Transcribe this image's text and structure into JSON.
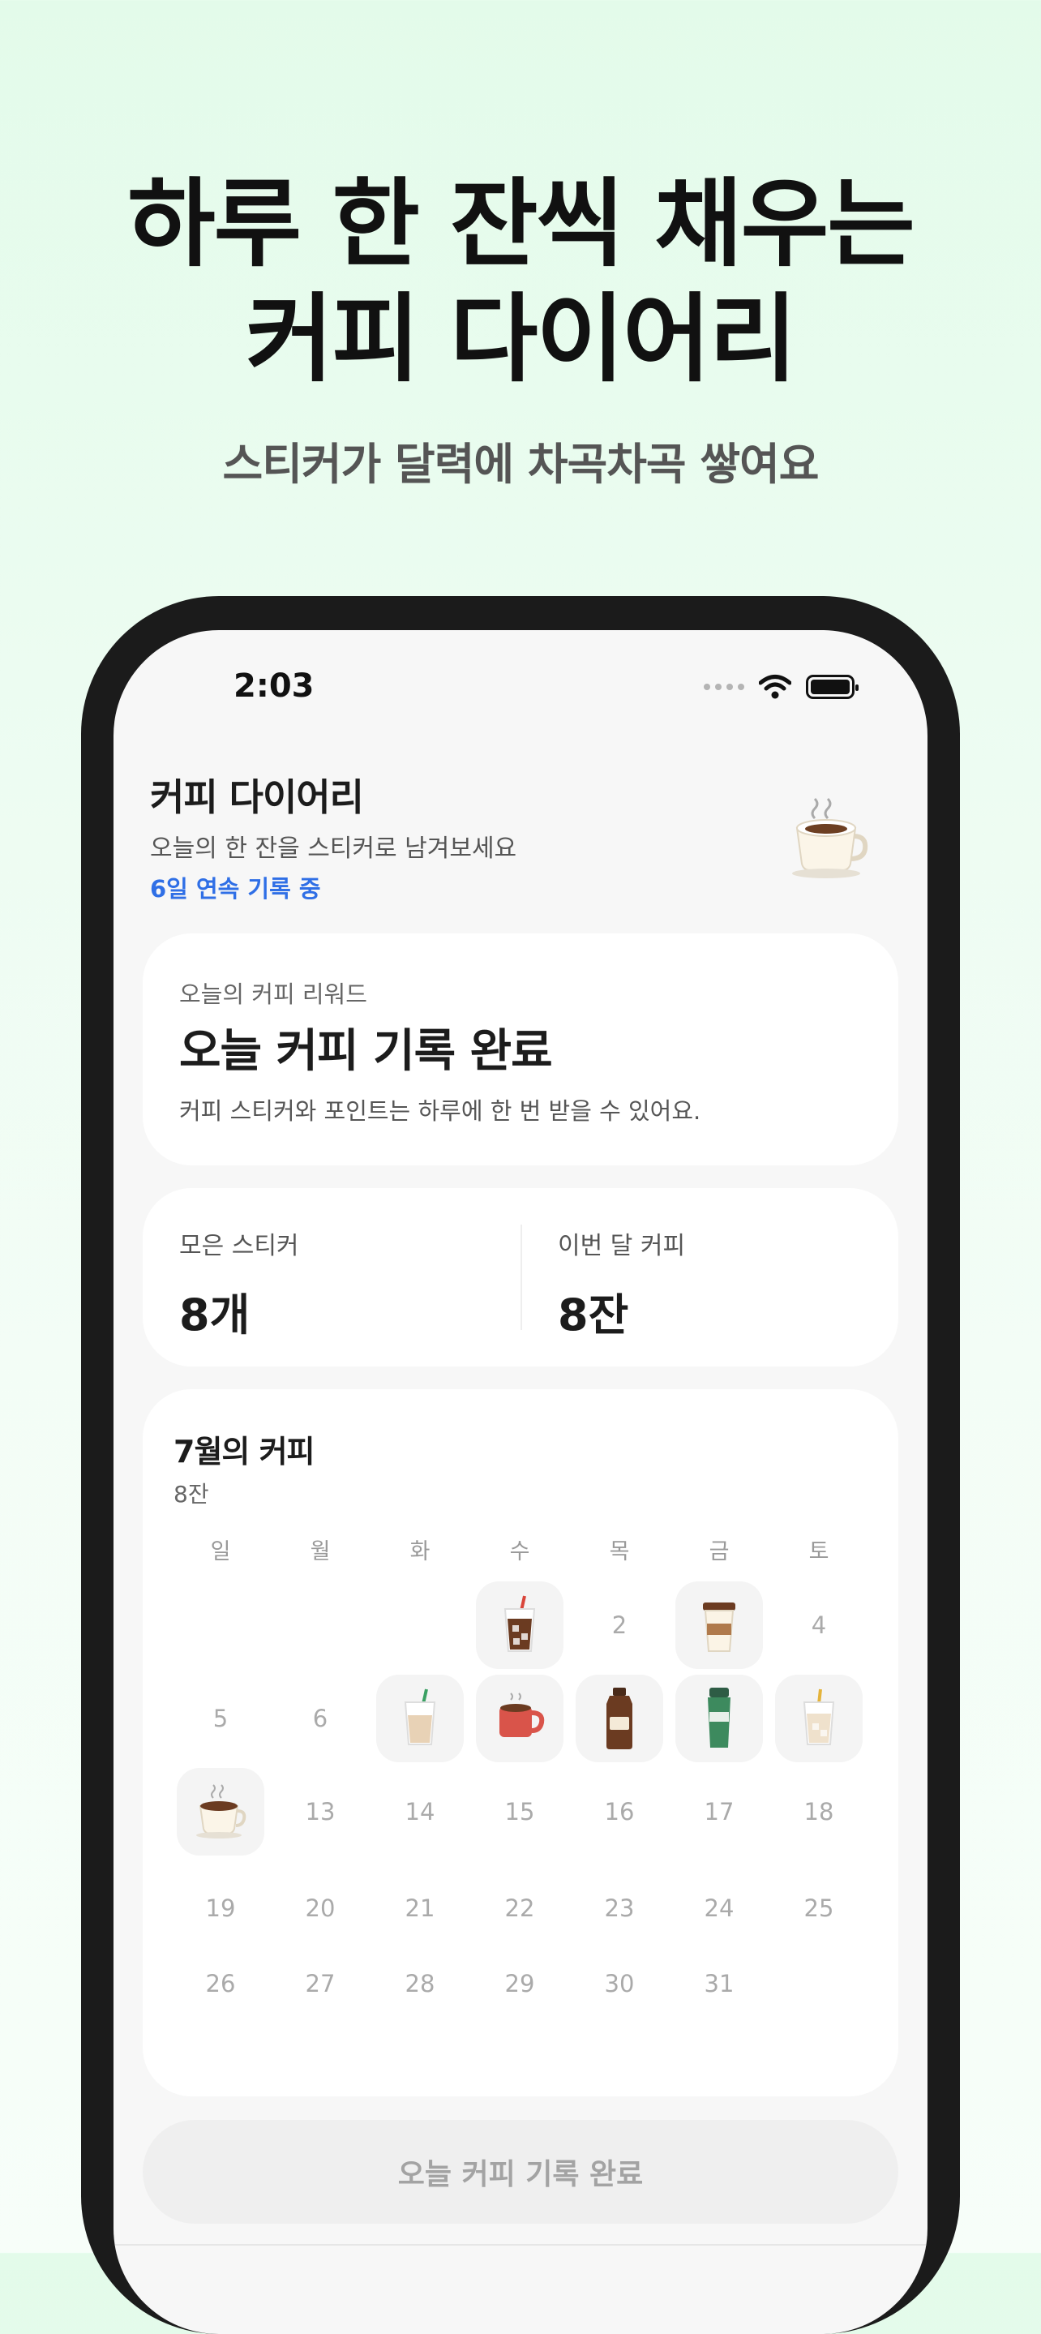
{
  "hero": {
    "title_line1": "하루 한 잔씩 채우는",
    "title_line2": "커피 다이어리",
    "subtitle": "스티커가 달력에 차곡차곡 쌓여요"
  },
  "status_bar": {
    "time": "2:03"
  },
  "header": {
    "title": "커피 다이어리",
    "subtitle": "오늘의 한 잔을 스티커로 남겨보세요",
    "streak": "6일 연속 기록 중"
  },
  "reward": {
    "label": "오늘의 커피 리워드",
    "title": "오늘 커피 기록 완료",
    "description": "커피 스티커와 포인트는 하루에 한 번 받을 수 있어요."
  },
  "stats": {
    "stickers_label": "모은 스티커",
    "stickers_value": "8개",
    "month_label": "이번 달 커피",
    "month_value": "8잔"
  },
  "calendar": {
    "title": "7월의 커피",
    "count": "8잔",
    "weekdays": [
      "일",
      "월",
      "화",
      "수",
      "목",
      "금",
      "토"
    ],
    "days": [
      {
        "d": "1",
        "sticker": "iced-americano-icon"
      },
      {
        "d": "2"
      },
      {
        "d": "3",
        "sticker": "takeout-cup-icon"
      },
      {
        "d": "4"
      },
      {
        "d": "5"
      },
      {
        "d": "6"
      },
      {
        "d": "7",
        "sticker": "iced-latte-icon"
      },
      {
        "d": "8",
        "sticker": "red-mug-icon"
      },
      {
        "d": "9",
        "sticker": "cold-brew-bottle-icon"
      },
      {
        "d": "10",
        "sticker": "green-tumbler-icon"
      },
      {
        "d": "11",
        "sticker": "milk-tea-icon"
      },
      {
        "d": "12",
        "sticker": "hot-coffee-cup-icon"
      },
      {
        "d": "13"
      },
      {
        "d": "14"
      },
      {
        "d": "15"
      },
      {
        "d": "16"
      },
      {
        "d": "17"
      },
      {
        "d": "18"
      },
      {
        "d": "19"
      },
      {
        "d": "20"
      },
      {
        "d": "21"
      },
      {
        "d": "22"
      },
      {
        "d": "23"
      },
      {
        "d": "24"
      },
      {
        "d": "25"
      },
      {
        "d": "26"
      },
      {
        "d": "27"
      },
      {
        "d": "28"
      },
      {
        "d": "29"
      },
      {
        "d": "30"
      },
      {
        "d": "31"
      }
    ]
  },
  "bottom_button": {
    "label": "오늘 커피 기록 완료"
  },
  "colors": {
    "accent_blue": "#2f6fe6",
    "hero_bg": "#e3fbea"
  }
}
